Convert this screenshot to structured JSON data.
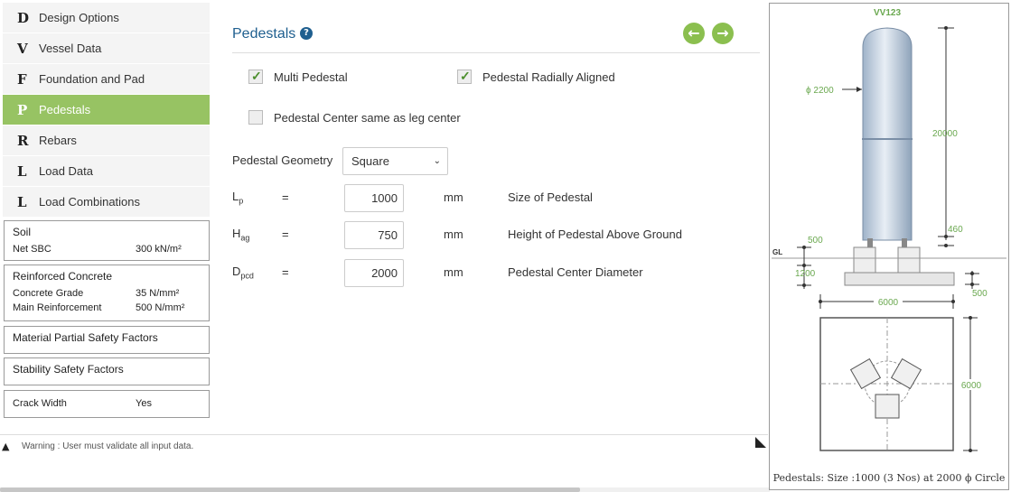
{
  "sidebar": {
    "items": [
      {
        "letter": "D",
        "label": "Design Options"
      },
      {
        "letter": "V",
        "label": "Vessel Data"
      },
      {
        "letter": "F",
        "label": "Foundation and Pad"
      },
      {
        "letter": "P",
        "label": "Pedestals",
        "active": true
      },
      {
        "letter": "R",
        "label": "Rebars"
      },
      {
        "letter": "L",
        "label": "Load Data"
      },
      {
        "letter": "L",
        "label": "Load Combinations"
      }
    ]
  },
  "soil": {
    "title": "Soil",
    "net_sbc_label": "Net SBC",
    "net_sbc_value": "300 kN/m²"
  },
  "concrete": {
    "title": "Reinforced Concrete",
    "grade_label": "Concrete Grade",
    "grade_value": "35 N/mm²",
    "reinf_label": "Main Reinforcement",
    "reinf_value": "500 N/mm²"
  },
  "material_factors": {
    "title": "Material Partial Safety Factors"
  },
  "stability_factors": {
    "title": "Stability Safety Factors"
  },
  "crack": {
    "label": "Crack Width",
    "value": "Yes"
  },
  "warning": {
    "text": "Warning : User must validate all input data."
  },
  "main": {
    "title": "Pedestals",
    "help_icon": "question-circle-icon",
    "prev_icon": "arrow-left-circle-icon",
    "next_icon": "arrow-right-circle-icon",
    "accent_color": "#8bbf4f",
    "title_color": "#1f5f8f"
  },
  "options": {
    "multi_pedestal": {
      "label": "Multi Pedestal",
      "checked": true
    },
    "radially_aligned": {
      "label": "Pedestal Radially Aligned",
      "checked": true
    },
    "center_same": {
      "label": "Pedestal Center same as leg center",
      "checked": false
    }
  },
  "geometry": {
    "label": "Pedestal Geometry",
    "value": "Square"
  },
  "params": [
    {
      "sym": "L",
      "sub": "p",
      "eq": "=",
      "value": "1000",
      "unit": "mm",
      "desc": "Size of Pedestal"
    },
    {
      "sym": "H",
      "sub": "ag",
      "eq": "=",
      "value": "750",
      "unit": "mm",
      "desc": "Height of Pedestal Above Ground"
    },
    {
      "sym": "D",
      "sub": "pcd",
      "eq": "=",
      "value": "2000",
      "unit": "mm",
      "desc": "Pedestal Center Diameter"
    }
  ],
  "drawing": {
    "vessel_name": "VV123",
    "diameter": "ϕ 2200",
    "height": "20000",
    "leg_dim": "460",
    "ped_dim": "500",
    "gl": "GL",
    "pad_depth": "1200",
    "pad_dim": "500",
    "width": "6000",
    "plan_width": "6000",
    "dim_color": "#6aa84f",
    "caption": "Pedestals: Size :1000 (3 Nos) at 2000 ϕ Circle"
  }
}
